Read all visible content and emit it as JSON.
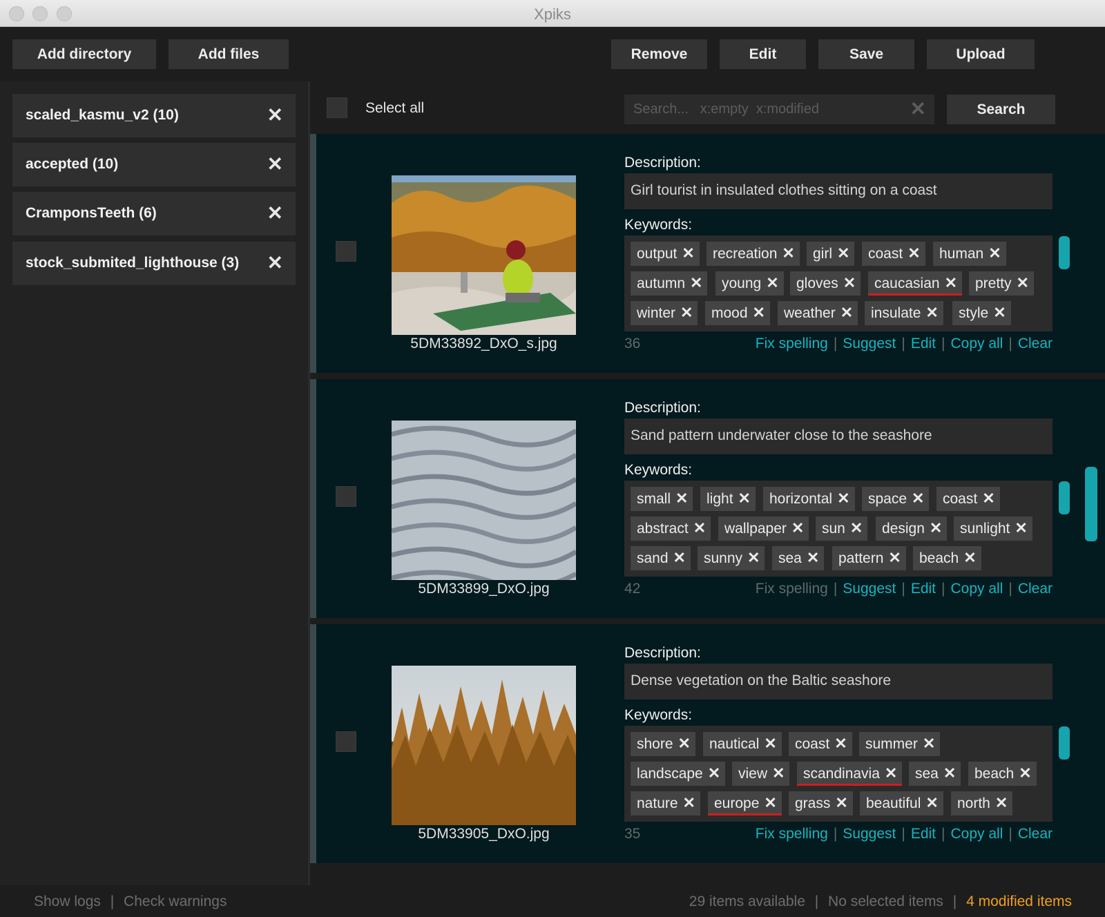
{
  "window": {
    "title": "Xpiks"
  },
  "toolbar": {
    "add_directory": "Add directory",
    "add_files": "Add files",
    "remove": "Remove",
    "edit": "Edit",
    "save": "Save",
    "upload": "Upload"
  },
  "sidebar": {
    "directories": [
      {
        "label": "scaled_kasmu_v2 (10)"
      },
      {
        "label": "accepted (10)"
      },
      {
        "label": "CramponsTeeth (6)"
      },
      {
        "label": "stock_submited_lighthouse (3)"
      }
    ],
    "close_glyph": "✕"
  },
  "filter": {
    "select_all": "Select all",
    "search_placeholder": "Search...   x:empty  x:modified",
    "search_button": "Search",
    "clear_glyph": "✕"
  },
  "artworks": [
    {
      "filename": "5DM33892_DxO_s.jpg",
      "description_label": "Description:",
      "description": "Girl tourist in insulated clothes sitting on a coast",
      "keywords_label": "Keywords:",
      "keywords": [
        {
          "text": "output"
        },
        {
          "text": "recreation"
        },
        {
          "text": "girl"
        },
        {
          "text": "coast"
        },
        {
          "text": "human"
        },
        {
          "text": "autumn"
        },
        {
          "text": "young"
        },
        {
          "text": "gloves"
        },
        {
          "text": "caucasian",
          "misspelled": true
        },
        {
          "text": "pretty"
        },
        {
          "text": "winter"
        },
        {
          "text": "mood"
        },
        {
          "text": "weather"
        },
        {
          "text": "insulate"
        },
        {
          "text": "style"
        }
      ],
      "keyword_count": "36",
      "actions": {
        "fix_spelling": "Fix spelling",
        "suggest": "Suggest",
        "edit": "Edit",
        "copy_all": "Copy all",
        "clear": "Clear"
      },
      "fix_spelling_enabled": true
    },
    {
      "filename": "5DM33899_DxO.jpg",
      "description_label": "Description:",
      "description": "Sand pattern underwater close to the seashore",
      "keywords_label": "Keywords:",
      "keywords": [
        {
          "text": "small"
        },
        {
          "text": "light"
        },
        {
          "text": "horizontal"
        },
        {
          "text": "space"
        },
        {
          "text": "coast"
        },
        {
          "text": "abstract"
        },
        {
          "text": "wallpaper"
        },
        {
          "text": "sun"
        },
        {
          "text": "design"
        },
        {
          "text": "sunlight"
        },
        {
          "text": "sand"
        },
        {
          "text": "sunny"
        },
        {
          "text": "sea"
        },
        {
          "text": "pattern"
        },
        {
          "text": "beach"
        }
      ],
      "keyword_count": "42",
      "actions": {
        "fix_spelling": "Fix spelling",
        "suggest": "Suggest",
        "edit": "Edit",
        "copy_all": "Copy all",
        "clear": "Clear"
      },
      "fix_spelling_enabled": false
    },
    {
      "filename": "5DM33905_DxO.jpg",
      "description_label": "Description:",
      "description": "Dense vegetation on the Baltic seashore",
      "keywords_label": "Keywords:",
      "keywords": [
        {
          "text": "shore"
        },
        {
          "text": "nautical"
        },
        {
          "text": "coast"
        },
        {
          "text": "summer"
        },
        {
          "text": "landscape"
        },
        {
          "text": "view"
        },
        {
          "text": "scandinavia",
          "misspelled": true
        },
        {
          "text": "sea"
        },
        {
          "text": "beach"
        },
        {
          "text": "nature"
        },
        {
          "text": "europe",
          "misspelled": true
        },
        {
          "text": "grass"
        },
        {
          "text": "beautiful"
        },
        {
          "text": "north"
        }
      ],
      "keyword_count": "35",
      "actions": {
        "fix_spelling": "Fix spelling",
        "suggest": "Suggest",
        "edit": "Edit",
        "copy_all": "Copy all",
        "clear": "Clear"
      },
      "fix_spelling_enabled": true
    }
  ],
  "statusbar": {
    "show_logs": "Show logs",
    "check_warnings": "Check warnings",
    "items_available": "29 items available",
    "selected": "No selected items",
    "modified": "4 modified items",
    "separator": "|"
  },
  "colors": {
    "accent": "#19b5c0",
    "modified": "#f0a01b",
    "misspelled": "#cc1f1f"
  }
}
